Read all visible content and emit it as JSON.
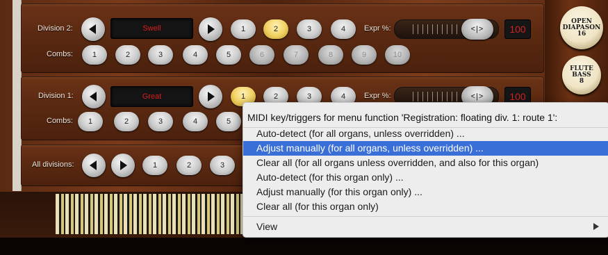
{
  "division2": {
    "label": "Division 2:",
    "display": "Swell",
    "buttons": [
      "1",
      "2",
      "3",
      "4"
    ],
    "expr_label": "Expr %:",
    "expr_value": "100",
    "knob_text": "<|>"
  },
  "combs2": {
    "label": "Combs:",
    "buttons": [
      "1",
      "2",
      "3",
      "4",
      "5",
      "6",
      "7",
      "8",
      "9",
      "10"
    ]
  },
  "division1": {
    "label": "Division 1:",
    "display": "Great",
    "buttons": [
      "1",
      "2",
      "3",
      "4"
    ],
    "expr_label": "Expr %:",
    "expr_value": "100",
    "knob_text": "<|>"
  },
  "combs1": {
    "label": "Combs:",
    "buttons": [
      "1",
      "2",
      "3",
      "4",
      "5"
    ]
  },
  "all_divisions": {
    "label": "All divisions:",
    "buttons": [
      "1",
      "2",
      "3"
    ]
  },
  "stops": {
    "open_diapason": [
      "OPEN",
      "DIAPASON",
      "16"
    ],
    "flute_bass": [
      "FLUTE",
      "BASS",
      "8"
    ]
  },
  "context_menu": {
    "title": "MIDI key/triggers for menu function 'Registration: floating div. 1: route 1':",
    "items": [
      "Auto-detect (for all organs, unless overridden) ...",
      "Adjust manually (for all organs, unless overridden) ...",
      "Clear all (for all organs unless overridden, and also for this organ)",
      "Auto-detect (for this organ only) ...",
      "Adjust manually (for this organ only) ...",
      "Clear all (for this organ only)"
    ],
    "view_label": "View"
  },
  "colors": {
    "highlight": "#3a6fd8",
    "lcd_text": "#d81e1e",
    "lit_button": "#f0d060"
  }
}
